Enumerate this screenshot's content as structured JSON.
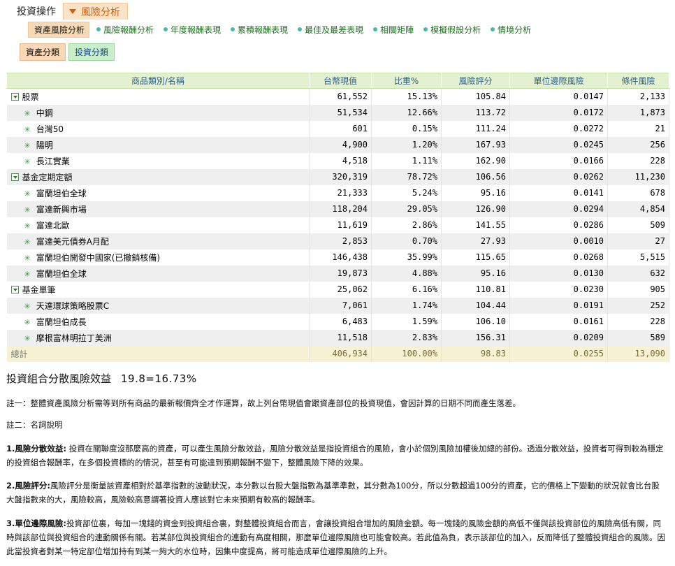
{
  "topnav": {
    "items": [
      "投資操作",
      "風險分析"
    ],
    "active_index": 1
  },
  "subnav": {
    "items": [
      "資產風險分析",
      "風險報酬分析",
      "年度報酬表現",
      "累積報酬表現",
      "最佳及最差表現",
      "相關矩陣",
      "模擬假設分析",
      "情境分析"
    ],
    "active_index": 0
  },
  "tabs": {
    "items": [
      "資產分類",
      "投資分類"
    ],
    "active_index": 0
  },
  "table": {
    "columns": [
      "商品類別/名稱",
      "台幣現值",
      "比重%",
      "風險評分",
      "單位邊際風險",
      "條件風險"
    ],
    "rows": [
      {
        "type": "group",
        "name": "股票",
        "value": "61,552",
        "weight": "15.13%",
        "score": "105.84",
        "marginal": "0.0147",
        "conditional": "2,133"
      },
      {
        "type": "child",
        "name": "中鋼",
        "value": "51,534",
        "weight": "12.66%",
        "score": "113.72",
        "marginal": "0.0172",
        "conditional": "1,873"
      },
      {
        "type": "child",
        "name": "台灣50",
        "value": "601",
        "weight": "0.15%",
        "score": "111.24",
        "marginal": "0.0272",
        "conditional": "21"
      },
      {
        "type": "child",
        "name": "陽明",
        "value": "4,900",
        "weight": "1.20%",
        "score": "167.93",
        "marginal": "0.0245",
        "conditional": "256"
      },
      {
        "type": "child",
        "name": "長江實業",
        "value": "4,518",
        "weight": "1.11%",
        "score": "162.90",
        "marginal": "0.0166",
        "conditional": "228"
      },
      {
        "type": "group",
        "name": "基金定期定額",
        "value": "320,319",
        "weight": "78.72%",
        "score": "106.56",
        "marginal": "0.0262",
        "conditional": "11,230"
      },
      {
        "type": "child",
        "name": "富蘭坦伯全球",
        "value": "21,333",
        "weight": "5.24%",
        "score": "95.16",
        "marginal": "0.0141",
        "conditional": "678"
      },
      {
        "type": "child",
        "name": "富達新興市場",
        "value": "118,204",
        "weight": "29.05%",
        "score": "126.90",
        "marginal": "0.0294",
        "conditional": "4,854"
      },
      {
        "type": "child",
        "name": "富達北歐",
        "value": "11,619",
        "weight": "2.86%",
        "score": "141.55",
        "marginal": "0.0286",
        "conditional": "509"
      },
      {
        "type": "child",
        "name": "富達美元債券A月配",
        "value": "2,853",
        "weight": "0.70%",
        "score": "27.93",
        "marginal": "0.0010",
        "conditional": "27"
      },
      {
        "type": "child",
        "name": "富蘭坦伯開發中國家(已撤銷核備)",
        "value": "146,438",
        "weight": "35.99%",
        "score": "115.65",
        "marginal": "0.0268",
        "conditional": "5,515"
      },
      {
        "type": "child",
        "name": "富蘭坦伯全球",
        "value": "19,873",
        "weight": "4.88%",
        "score": "95.16",
        "marginal": "0.0130",
        "conditional": "632"
      },
      {
        "type": "group",
        "name": "基金單筆",
        "value": "25,062",
        "weight": "6.16%",
        "score": "110.81",
        "marginal": "0.0230",
        "conditional": "905"
      },
      {
        "type": "child",
        "name": "天達環球策略股票C",
        "value": "7,061",
        "weight": "1.74%",
        "score": "104.44",
        "marginal": "0.0191",
        "conditional": "252"
      },
      {
        "type": "child",
        "name": "富蘭坦伯成長",
        "value": "6,483",
        "weight": "1.59%",
        "score": "106.10",
        "marginal": "0.0161",
        "conditional": "228"
      },
      {
        "type": "child",
        "name": "摩根富林明拉丁美洲",
        "value": "11,518",
        "weight": "2.83%",
        "score": "156.31",
        "marginal": "0.0209",
        "conditional": "589"
      },
      {
        "type": "total",
        "name": "總計",
        "value": "406,934",
        "weight": "100.00%",
        "score": "98.83",
        "marginal": "0.0255",
        "conditional": "13,090"
      }
    ]
  },
  "summary": {
    "label": "投資組合分散風險效益",
    "value": "19.8=16.73%"
  },
  "notes": {
    "note1": "註一：整體資產風險分析需等到所有商品的最新報價齊全才作運算，故上列台幣現值會跟資產部位的投資現值，會因計算的日期不同而產生落差。",
    "note2": "註二：名詞說明",
    "def1_title": "1.風險分散效益:",
    "def1_text": " 投資在關聯度沒那麼高的資產，可以產生風險分散效益，風險分散效益是指投資組合的風險，會小於個別風險加權後加總的部份。透過分散效益，投資者可得到較為穩定的投資組合報酬率，在多個投資標的的情況，甚至有可能達到預期報酬不變下，整體風險下降的效果。",
    "def2_title": "2.風險評分:",
    "def2_text": "風險評分是衡量該資產相對於基準指數的波動狀況，本分數以台股大盤指數為基準準數，其分數為100分，所以分數超過100分的資產，它的價格上下變動的狀況就會比台股大盤指數來的大，風險較高，風險較高意謂著投資人應該對它未來預期有較高的報酬率。",
    "def3_title": "3.單位邊際風險:",
    "def3_text": "投資部位裏，每加一塊錢的資金到投資組合裏，對整體投資組合而言，會讓投資組合增加的風險金額。每一塊錢的風險金額的高低不僅與該投資部位的風險高低有關，同時與該部位與投資組合的連動關係有關。若某部位與投資組合的連動有高度相關，那麼單位邊際風險也可能會較高。若此值為負，表示該部位的加入，反而降低了整體投資組合的風險。因此當投資者對某一特定部位增加持有到某一夠大的水位時，因集中度提高，將可能造成單位邊際風險的上升。"
  }
}
